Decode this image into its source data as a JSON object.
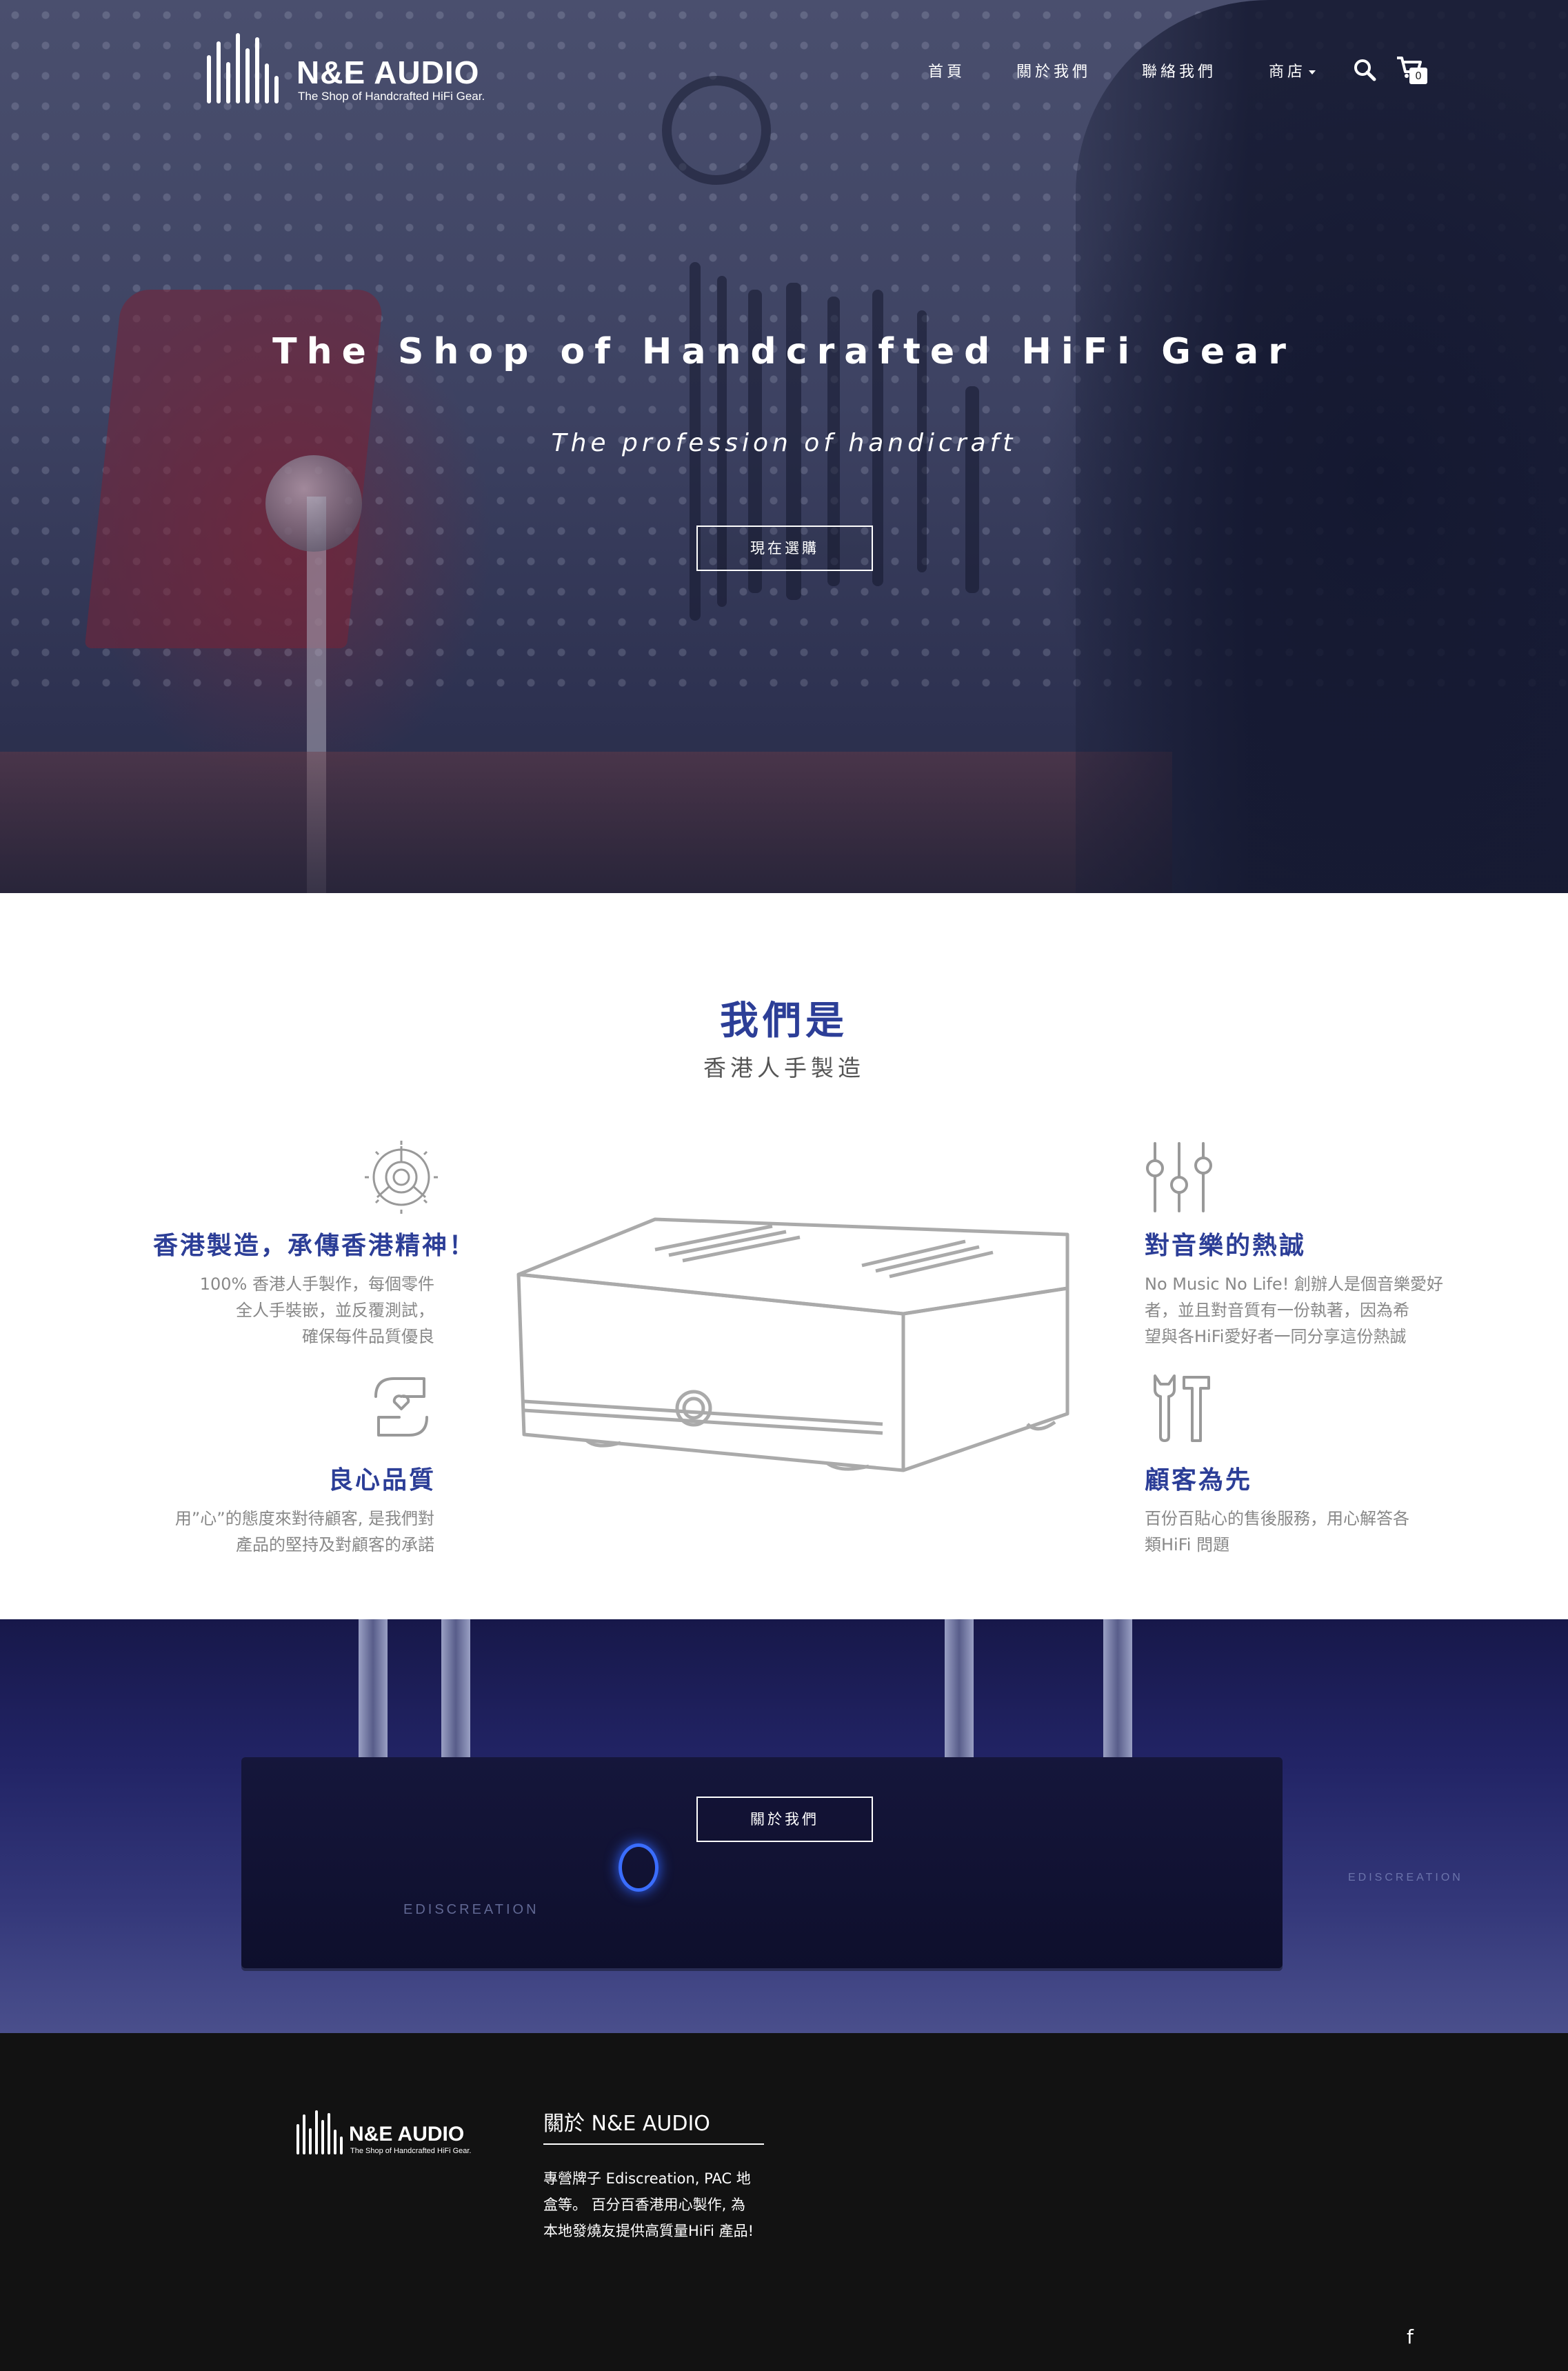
{
  "brand": {
    "name": "N&E AUDIO",
    "tagline": "The Shop of Handcrafted HiFi Gear."
  },
  "nav": {
    "items": [
      "首頁",
      "關於我們",
      "聯絡我們",
      "商店"
    ],
    "cart_count": "0"
  },
  "hero": {
    "title": "The Shop of Handcrafted HiFi Gear",
    "subtitle": "The profession of handicraft",
    "button": "現在選購"
  },
  "about": {
    "title": "我們是",
    "subtitle": "香港人手製造",
    "features": [
      {
        "title": "香港製造，承傳香港精神！",
        "desc": [
          "100% 香港人手製作，每個零件",
          "全人手裝嵌，並反覆測試，",
          "確保每件品質優良"
        ],
        "icon": "gear-icon"
      },
      {
        "title": "良心品質",
        "desc": [
          "用”心”的態度來對待顧客, 是我們對",
          "產品的堅持及對顧客的承諾"
        ],
        "icon": "hands-heart-icon"
      },
      {
        "title": "對音樂的熱誠",
        "desc": [
          "No Music No Life! 創辦人是個音樂愛好",
          "者，並且對音質有一份執著，因為希",
          "望與各HiFi愛好者一同分享這份熱誠"
        ],
        "icon": "sliders-icon"
      },
      {
        "title": "顧客為先",
        "desc": [
          "百份百貼心的售後服務，用心解答各",
          "類HiFi 問題"
        ],
        "icon": "tools-icon"
      }
    ]
  },
  "band": {
    "button": "關於我們",
    "brand_mark": "EDISCREATION"
  },
  "footer": {
    "heading": "關於 N&E AUDIO",
    "text": [
      "專營牌子 Ediscreation, PAC 地",
      "盒等。 百分百香港用心製作, 為",
      "本地發燒友提供高質量HiFi 產品!"
    ],
    "social": "f"
  },
  "colors": {
    "accent": "#2c3e97",
    "footer_bg": "#121212",
    "band": "#222466"
  }
}
